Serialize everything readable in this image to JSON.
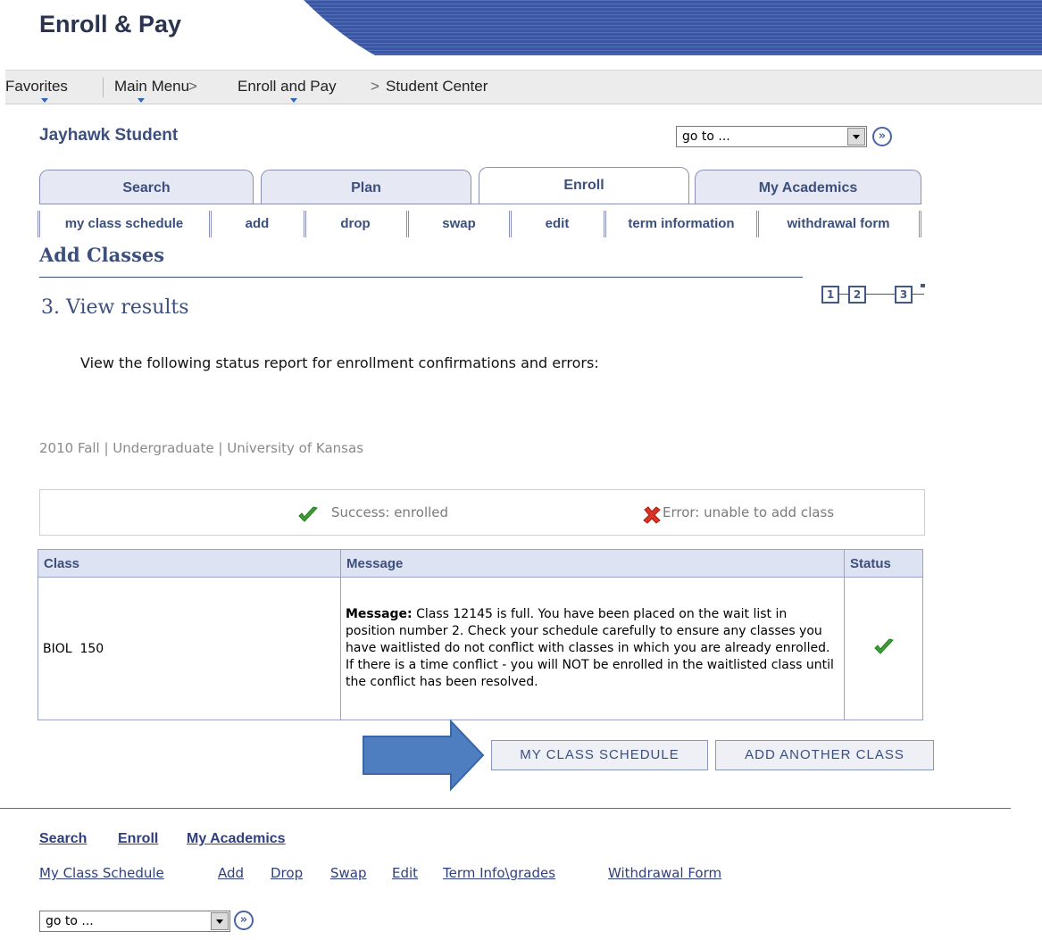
{
  "header": {
    "title": "Enroll & Pay"
  },
  "nav": {
    "favorites": "Favorites",
    "main_menu": "Main Menu",
    "sep": ">",
    "enroll_pay": "Enroll and Pay",
    "student_center": "Student Center"
  },
  "student_name": "Jayhawk Student",
  "goto": {
    "value": "go to ...",
    "go_glyph": "»"
  },
  "tabs": [
    {
      "label": "Search"
    },
    {
      "label": "Plan"
    },
    {
      "label": "Enroll",
      "active": true
    },
    {
      "label": "My Academics"
    }
  ],
  "subtabs": [
    "my class schedule",
    "add",
    "drop",
    "swap",
    "edit",
    "term information",
    "withdrawal form"
  ],
  "page_title": "Add Classes",
  "steps": [
    "1",
    "2",
    "3"
  ],
  "step_heading": "3.  View results",
  "instructions": "View the following status report for enrollment confirmations and errors:",
  "term_line": "2010 Fall | Undergraduate | University of Kansas",
  "legend": {
    "success": "Success: enrolled",
    "error": "Error: unable to add class"
  },
  "results": {
    "headers": [
      "Class",
      "Message",
      "Status"
    ],
    "rows": [
      {
        "class": "BIOL  150",
        "message_label": "Message:",
        "message": " Class 12145 is full. You have been placed on the wait list in position number 2. Check your schedule carefully to ensure any classes you have waitlisted do not conflict with classes in which you are already enrolled. If there is a time conflict - you will NOT be enrolled in the waitlisted class until the conflict has been resolved.",
        "status": "success"
      }
    ]
  },
  "buttons": {
    "my_schedule": "My Class Schedule",
    "add_another": "Add Another Class"
  },
  "footer": {
    "links1": [
      "Search",
      "Enroll",
      "My Academics"
    ],
    "links2": [
      "My Class Schedule",
      "Add",
      "Drop",
      "Swap",
      "Edit",
      "Term Info\\grades",
      "Withdrawal Form"
    ]
  },
  "colors": {
    "brand": "#3c4f7d",
    "header_band": "#3a57a6",
    "success": "#3aa131",
    "error": "#d93326",
    "arrow": "#4f7ec0"
  }
}
